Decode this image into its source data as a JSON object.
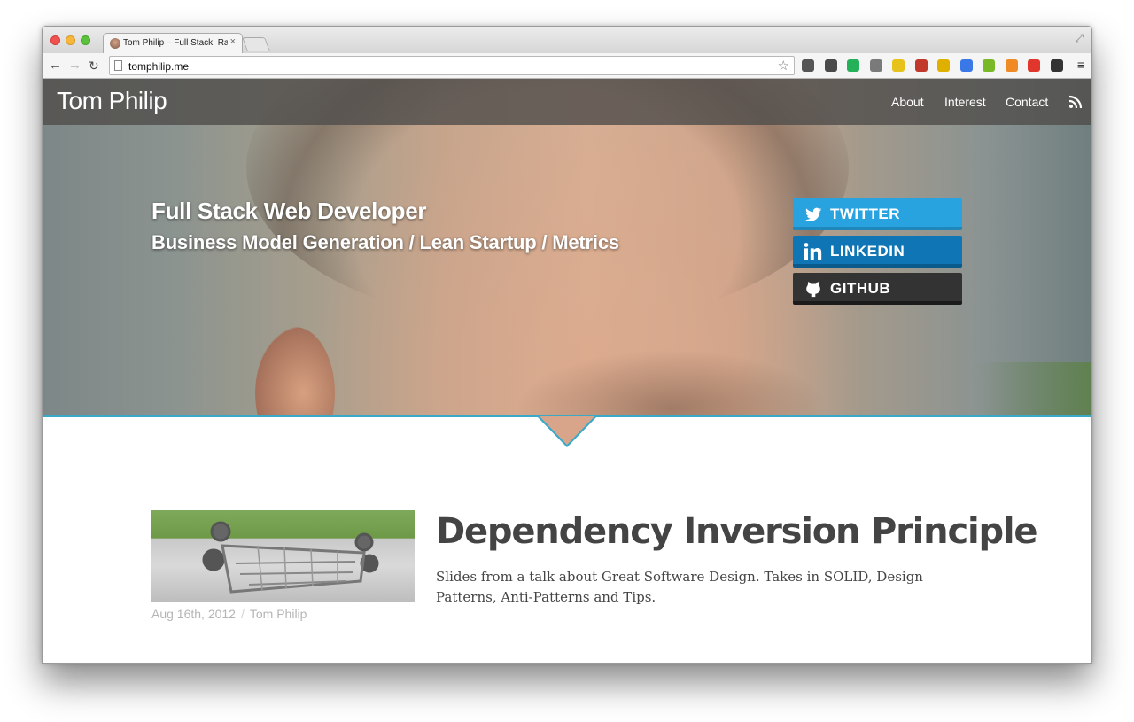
{
  "browser": {
    "tab_title": "Tom Philip – Full Stack, Ra",
    "tab_close": "×",
    "url": "tomphilip.me",
    "nav": {
      "back": "←",
      "forward": "→",
      "reload": "↻"
    },
    "star": "☆",
    "menu": "≡",
    "extensions": [
      {
        "name": "ext-dark-icon",
        "color": "#555555"
      },
      {
        "name": "evernote-icon",
        "color": "#4a4a4a"
      },
      {
        "name": "ext-green-icon",
        "color": "#25b05a"
      },
      {
        "name": "ext-tool-icon",
        "color": "#7a7a7a"
      },
      {
        "name": "ext-yellow-icon",
        "color": "#e6c21a"
      },
      {
        "name": "ext-red-icon",
        "color": "#c0392b"
      },
      {
        "name": "ext-phone-icon",
        "color": "#e0b000"
      },
      {
        "name": "translate-icon",
        "color": "#3b78e7"
      },
      {
        "name": "ext-diamond-icon",
        "color": "#79b928"
      },
      {
        "name": "pbush-icon",
        "color": "#f08a24"
      },
      {
        "name": "adblock-icon",
        "color": "#e0362c"
      },
      {
        "name": "cast-icon",
        "color": "#333333"
      }
    ]
  },
  "site": {
    "brand": "Tom Philip",
    "nav": [
      "About",
      "Interest",
      "Contact"
    ],
    "headline": "Full Stack Web Developer",
    "subline": "Business Model Generation / Lean Startup / Metrics",
    "social": [
      {
        "label": "TWITTER",
        "color": "#29a3e0"
      },
      {
        "label": "LINKEDIN",
        "color": "#0f75b4"
      },
      {
        "label": "GITHUB",
        "color": "#333333"
      }
    ],
    "accent": "#3aa9c9"
  },
  "post": {
    "title": "Dependency Inversion Principle",
    "excerpt": "Slides from a talk about Great Software Design. Takes in SOLID, Design Patterns, Anti-Patterns and Tips.",
    "date": "Aug 16th, 2012",
    "separator": "/",
    "author": "Tom Philip"
  }
}
